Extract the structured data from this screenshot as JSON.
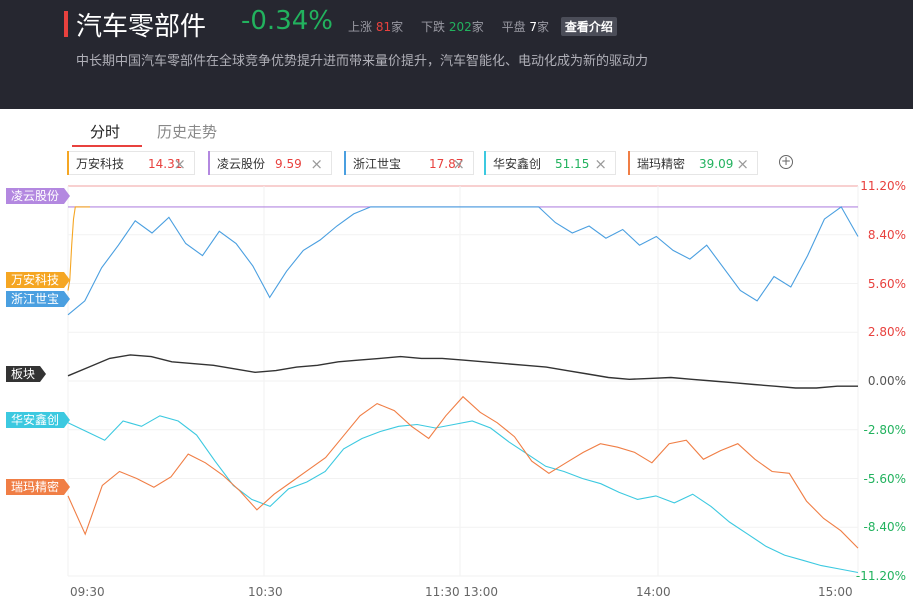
{
  "header": {
    "title": "汽车零部件",
    "change": "-0.34%",
    "up_label": "上涨",
    "up_count": "81",
    "up_unit": "家",
    "down_label": "下跌",
    "down_count": "202",
    "down_unit": "家",
    "flat_label": "平盘",
    "flat_count": "7",
    "flat_unit": "家",
    "intro_button": "查看介绍",
    "description": "中长期中国汽车零部件在全球竞争优势提升进而带来量价提升，汽车智能化、电动化成为新的驱动力"
  },
  "tabs": {
    "intraday": "分时",
    "history": "历史走势"
  },
  "chips": [
    {
      "name": "万安科技",
      "price": "14.31",
      "color": "#f5a623",
      "dir": "up"
    },
    {
      "name": "凌云股份",
      "price": "9.59",
      "color": "#b388e0",
      "dir": "up"
    },
    {
      "name": "浙江世宝",
      "price": "17.87",
      "color": "#4a9fe0",
      "dir": "up"
    },
    {
      "name": "华安鑫创",
      "price": "51.15",
      "color": "#3cc9e0",
      "dir": "down"
    },
    {
      "name": "瑞玛精密",
      "price": "39.09",
      "color": "#f07e45",
      "dir": "down"
    }
  ],
  "close_glyph": "×",
  "add_glyph": "+",
  "chart_data": {
    "type": "line",
    "ylim": [
      -11.2,
      11.2
    ],
    "y_ticks": [
      "11.20%",
      "8.40%",
      "5.60%",
      "2.80%",
      "0.00%",
      "-2.80%",
      "-5.60%",
      "-8.40%",
      "-11.20%"
    ],
    "x_ticks": [
      "09:30",
      "10:30",
      "11:30 13:00",
      "14:00",
      "15:00"
    ],
    "series": [
      {
        "name": "凌云股份",
        "color": "#b388e0",
        "values": [
          10.0,
          10.0,
          10.0,
          10.0,
          10.0,
          10.0,
          10.0,
          10.0,
          10.0,
          10.0,
          10.0,
          10.0,
          10.0
        ]
      },
      {
        "name": "万安科技",
        "color": "#f5a623",
        "values": [
          5.2,
          5.8,
          7.8,
          9.3,
          10.0,
          10.0,
          10.0,
          10.0,
          10.0,
          10.0,
          10.0,
          10.0,
          10.0
        ]
      },
      {
        "name": "浙江世宝",
        "color": "#4a9fe0",
        "values": [
          3.8,
          4.6,
          6.5,
          7.8,
          9.2,
          8.5,
          9.4,
          7.9,
          7.2,
          8.6,
          7.9,
          6.6,
          4.8,
          6.3,
          7.5,
          8.1,
          8.9,
          9.6,
          10.0,
          10.0,
          10.0,
          10.0,
          10.0,
          10.0,
          10.0,
          10.0,
          10.0,
          10.0,
          10.0,
          9.1,
          8.5,
          8.9,
          8.2,
          8.7,
          7.8,
          8.3,
          7.5,
          7.0,
          7.8,
          6.5,
          5.2,
          4.6,
          6.0,
          5.4,
          7.2,
          9.3,
          10.0,
          8.3
        ]
      },
      {
        "name": "板块",
        "color": "#333333",
        "values": [
          0.3,
          0.8,
          1.3,
          1.5,
          1.4,
          1.1,
          1.0,
          0.9,
          0.7,
          0.5,
          0.6,
          0.8,
          0.9,
          1.1,
          1.2,
          1.3,
          1.4,
          1.3,
          1.3,
          1.2,
          1.1,
          1.0,
          0.9,
          0.8,
          0.6,
          0.4,
          0.2,
          0.1,
          0.15,
          0.2,
          0.1,
          0.0,
          -0.1,
          -0.2,
          -0.3,
          -0.4,
          -0.4,
          -0.3,
          -0.3
        ]
      },
      {
        "name": "华安鑫创",
        "color": "#3cc9e0",
        "values": [
          -2.4,
          -2.9,
          -3.4,
          -2.3,
          -2.6,
          -2.0,
          -2.3,
          -3.1,
          -4.6,
          -6.0,
          -6.8,
          -7.2,
          -6.2,
          -5.8,
          -5.2,
          -3.9,
          -3.3,
          -2.9,
          -2.6,
          -2.5,
          -2.7,
          -2.5,
          -2.3,
          -2.7,
          -3.5,
          -4.2,
          -4.9,
          -5.2,
          -5.6,
          -5.9,
          -6.4,
          -6.8,
          -6.6,
          -7.0,
          -6.5,
          -7.2,
          -8.1,
          -8.8,
          -9.5,
          -10.0,
          -10.3,
          -10.6,
          -10.8,
          -11.0
        ]
      },
      {
        "name": "瑞玛精密",
        "color": "#f07e45",
        "values": [
          -6.6,
          -8.8,
          -6.0,
          -5.2,
          -5.6,
          -6.1,
          -5.5,
          -4.2,
          -4.7,
          -5.4,
          -6.3,
          -7.4,
          -6.5,
          -5.8,
          -5.1,
          -4.4,
          -3.2,
          -2.0,
          -1.3,
          -1.7,
          -2.6,
          -3.3,
          -2.0,
          -0.9,
          -1.8,
          -2.4,
          -3.2,
          -4.6,
          -5.3,
          -4.7,
          -4.1,
          -3.6,
          -3.8,
          -4.1,
          -4.7,
          -3.6,
          -3.4,
          -4.5,
          -4.0,
          -3.6,
          -4.5,
          -5.2,
          -5.3,
          -6.9,
          -7.9,
          -8.6,
          -9.6
        ]
      }
    ]
  }
}
